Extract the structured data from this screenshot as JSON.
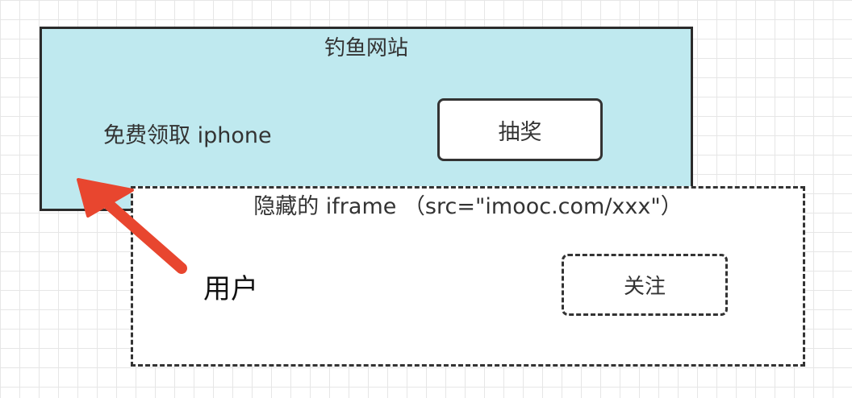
{
  "phishing_site": {
    "title": "钓鱼网站",
    "offer_text": "免费领取 iphone",
    "lottery_button": "抽奖"
  },
  "hidden_iframe": {
    "title": "隐藏的 iframe （src=\"imooc.com/xxx\"）",
    "follow_button": "关注"
  },
  "user_label": "用户",
  "colors": {
    "phishing_bg": "#bfe9ef",
    "arrow": "#e8462f",
    "border": "#2b2b2b"
  }
}
